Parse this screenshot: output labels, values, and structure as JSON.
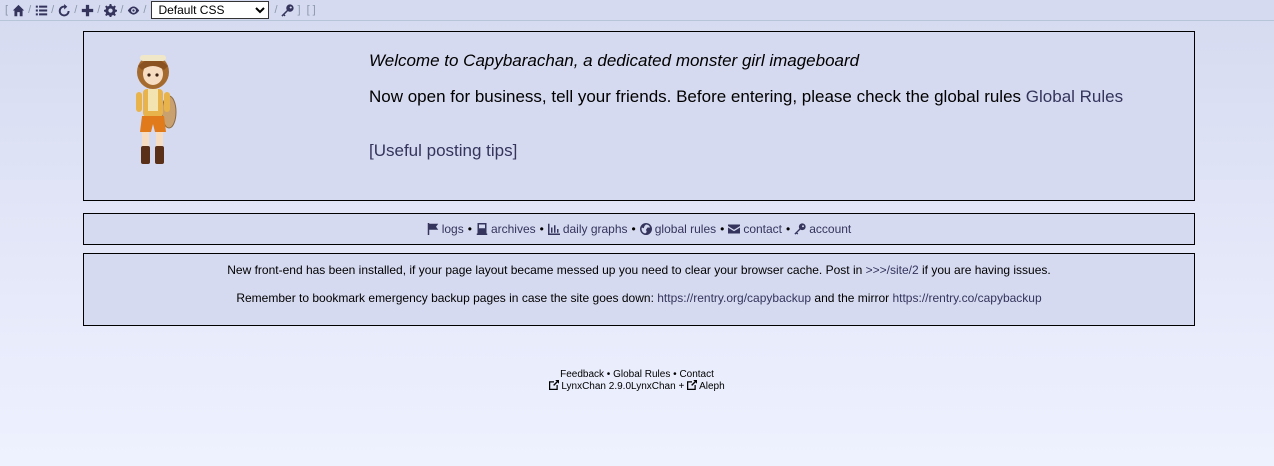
{
  "topbar": {
    "open_bracket": "[",
    "separator": "/",
    "close_bracket": "]",
    "empty_brackets": "[ ]",
    "css_select_value": "Default CSS",
    "icons": [
      "home-icon",
      "list-icon",
      "recycle-icon",
      "plus-icon",
      "gear-icon",
      "eye-icon",
      "key-icon"
    ]
  },
  "welcome": {
    "title": "Welcome to Capybarachan, a dedicated monster girl imageboard",
    "line_text": "Now open for business, tell your friends. Before entering, please check the global rules",
    "global_rules_link": "Global Rules",
    "tips_link": "[Useful posting tips]"
  },
  "links": {
    "bullet": "•",
    "items": [
      {
        "icon": "flag-icon",
        "label": "logs"
      },
      {
        "icon": "archive-icon",
        "label": "archives"
      },
      {
        "icon": "chart-icon",
        "label": "daily graphs"
      },
      {
        "icon": "globe-icon",
        "label": "global rules"
      },
      {
        "icon": "envelope-icon",
        "label": "contact"
      },
      {
        "icon": "key-icon",
        "label": "account"
      }
    ]
  },
  "news": {
    "line1_before": "New front-end has been installed, if your page layout became messed up you need to clear your browser cache. Post in ",
    "line1_link": ">>>/site/2",
    "line1_after": " if you are having issues.",
    "line2_before": "Remember to bookmark emergency backup pages in case the site goes down: ",
    "line2_link1": "https://rentry.org/capybackup",
    "line2_middle": " and the mirror ",
    "line2_link2": "https://rentry.co/capybackup"
  },
  "footer": {
    "feedback": "Feedback",
    "global_rules": "Global Rules",
    "contact": "Contact",
    "bullet": "•",
    "lynxchan": "LynxChan 2.9.0LynxChan",
    "plus": "+",
    "aleph": "Aleph"
  },
  "colors": {
    "link": "#34345c",
    "box_bg": "#d6daf0",
    "page_bg_bottom": "#eef2ff"
  }
}
